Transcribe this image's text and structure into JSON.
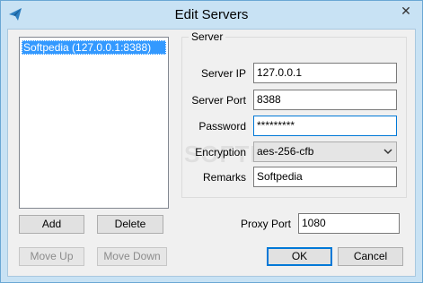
{
  "window": {
    "title": "Edit Servers",
    "close_glyph": "✕",
    "accent": "#3399ff",
    "frame_color": "#c8e2f4"
  },
  "server_list": {
    "items": [
      {
        "label": "Softpedia (127.0.0.1:8388)",
        "selected": true
      }
    ]
  },
  "buttons": {
    "add": "Add",
    "delete": "Delete",
    "move_up": "Move Up",
    "move_down": "Move Down",
    "ok": "OK",
    "cancel": "Cancel"
  },
  "server_group": {
    "legend": "Server",
    "server_ip_label": "Server IP",
    "server_ip_value": "127.0.0.1",
    "server_port_label": "Server Port",
    "server_port_value": "8388",
    "password_label": "Password",
    "password_value": "*********",
    "encryption_label": "Encryption",
    "encryption_value": "aes-256-cfb",
    "remarks_label": "Remarks",
    "remarks_value": "Softpedia"
  },
  "proxy": {
    "label": "Proxy Port",
    "value": "1080"
  },
  "watermark": "SOFTPEDIA"
}
